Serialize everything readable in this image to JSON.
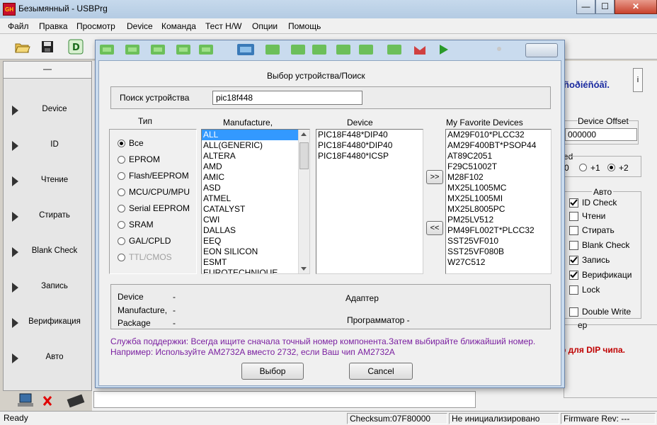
{
  "window": {
    "title": "Безымянный - USBPrg",
    "icon_label": "GH",
    "minimize": "—",
    "maximize": "☐",
    "close": "✕"
  },
  "menu": [
    "Файл",
    "Правка",
    "Просмотр",
    "Device",
    "Команда",
    "Тест H/W",
    "Опции",
    "Помощь"
  ],
  "left_panel": {
    "header": "—",
    "items": [
      "Device",
      "ID",
      "Чтение",
      "Стирать",
      "Blank Check",
      "Запись",
      "Верификация",
      "Авто"
    ]
  },
  "background": {
    "device_name_fragment": "ñoðiéñóâî.",
    "info_btn": "i",
    "device_offset_label": "Device Offset",
    "device_offset_value": "000000",
    "speed_fragment": "ed",
    "speed_options": [
      "0",
      "+1",
      "+2"
    ],
    "speed_selected": "+2",
    "auto_label": "Авто",
    "auto_items": [
      {
        "label": "ID Check",
        "checked": true
      },
      {
        "label": "Чтени",
        "checked": false
      },
      {
        "label": "Стирать",
        "checked": false
      },
      {
        "label": "Blank Check",
        "checked": false
      },
      {
        "label": "Запись",
        "checked": true
      },
      {
        "label": "Верификаци",
        "checked": true
      },
      {
        "label": "Lock",
        "checked": false
      },
      {
        "label": "Double Write",
        "checked": false
      }
    ],
    "adapter_fragment": "ер",
    "dip_note": "р для  DIP чипа."
  },
  "statusbar": {
    "ready": "Ready",
    "checksum": "Checksum:07F80000",
    "init": "Не инициализировано",
    "firmware": "Firmware Rev: ---"
  },
  "dialog": {
    "title": "Выбор устройства/Поиск",
    "search_label": "Поиск устройства",
    "search_value": "pic18f448",
    "type_label": "Тип",
    "types": [
      "Все",
      "EPROM",
      "Flash/EEPROM",
      "MCU/CPU/MPU",
      "Serial EEPROM",
      "SRAM",
      "GAL/CPLD",
      "TTL/CMOS"
    ],
    "type_selected": "Все",
    "manufacture_label": "Manufacture,",
    "manufacturers": [
      "ALL",
      "ALL(GENERIC)",
      "ALTERA",
      "AMD",
      "AMIC",
      "ASD",
      "ATMEL",
      "CATALYST",
      "CWI",
      "DALLAS",
      "EEQ",
      "EON SILICON",
      "ESMT",
      "EUROTECHNIQUE"
    ],
    "manufacturer_selected": "ALL",
    "device_label": "Device",
    "devices": [
      "PIC18F448*DIP40",
      "PIC18F4480*DIP40",
      "PIC18F4480*ICSP"
    ],
    "favorites_label": "My Favorite Devices",
    "favorites": [
      "AM29F010*PLCC32",
      "AM29F400BT*PSOP44",
      "AT89C2051",
      "F29C51002T",
      "M28F102",
      "MX25L1005MC",
      "MX25L1005MI",
      "MX25L8005PC",
      "PM25LV512",
      "PM49FL002T*PLCC32",
      "SST25VF010",
      "SST25VF080B",
      "W27C512"
    ],
    "add_fav": ">>",
    "remove_fav": "<<",
    "info": {
      "device_label": "Device",
      "device_value": "-",
      "manufacture_label": "Manufacture,",
      "manufacture_value": "-",
      "package_label": "Package",
      "package_value": "-",
      "adapter_label": "Адаптер",
      "programmer_label": "Программатор -"
    },
    "support_line1": "Служба поддержки: Всегда ищите сначала точный номер компонента.Затем выбирайте ближайший номер.",
    "support_line2": "Например: Используйте AM2732A вместо 2732, если Ваш чип AM2732A",
    "ok_button": "Выбор",
    "cancel_button": "Cancel",
    "colors": {
      "support_text": "#7a1fa0",
      "accent": "#3399ff"
    }
  }
}
